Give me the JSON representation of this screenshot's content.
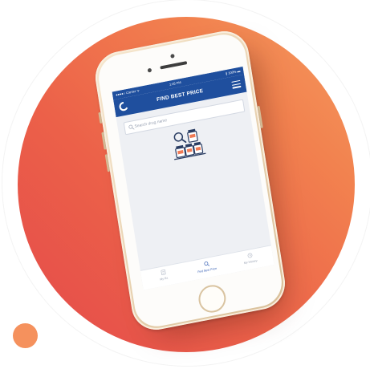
{
  "app": {
    "status_bar": {
      "carrier": "●●●●○ Carrier ᯤ",
      "time": "1:45 PM",
      "battery": "∦ 100% ▬"
    },
    "header": {
      "title": "FIND BEST PRICE"
    },
    "search": {
      "placeholder": "Search drug name"
    },
    "tabs": [
      {
        "label": "My Rx",
        "icon": "prescription-icon",
        "active": false
      },
      {
        "label": "Find Best Price",
        "icon": "search-icon",
        "active": true
      },
      {
        "label": "My History",
        "icon": "history-icon",
        "active": false
      }
    ]
  },
  "colors": {
    "brand_blue": "#1f4f9e",
    "gradient_start": "#e44a4a",
    "gradient_end": "#f59a5e",
    "phone_gold": "#e9d3b2"
  }
}
